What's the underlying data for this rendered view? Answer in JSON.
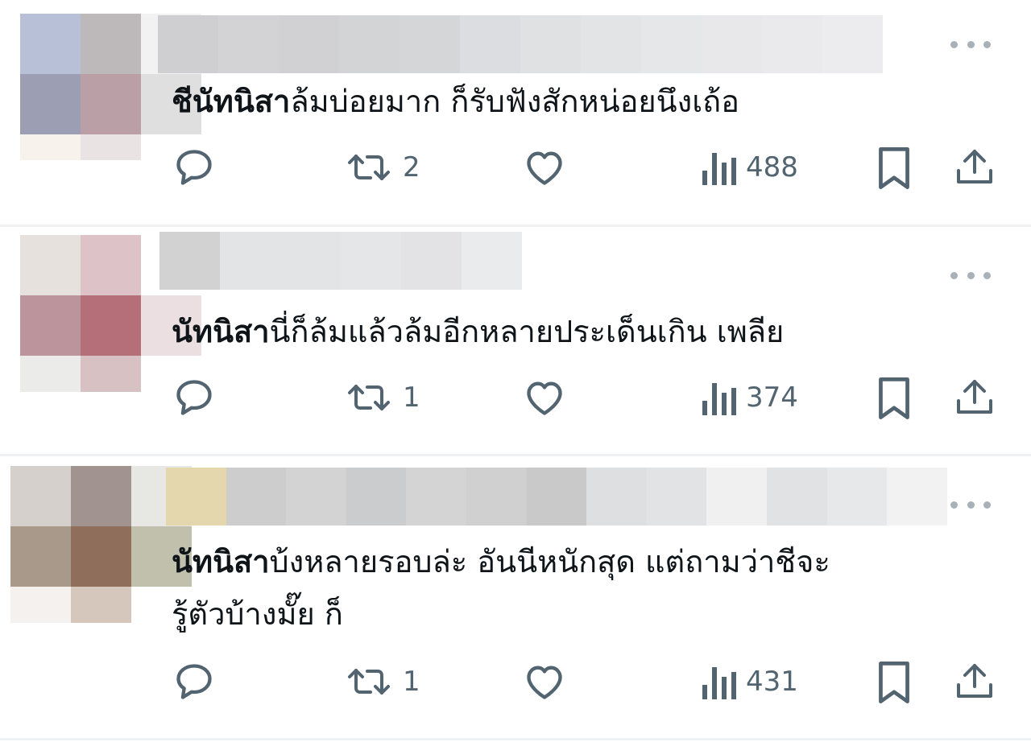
{
  "replies": [
    {
      "name": "ชีนัทนิสา",
      "text": "ล้มบ่อยมาก ก็รับฟังสักหน่อยนึงเถ้อ",
      "retweets": "2",
      "views": "488"
    },
    {
      "name": "นัทนิสา",
      "text": "นี่ก็ล้มแล้วล้มอีกหลายประเด็นเกิน เพลีย",
      "retweets": "1",
      "views": "374"
    },
    {
      "name": "นัทนิสา",
      "text": "บ้งหลายรอบล่ะ อันนีหนักสุด แต่ถามว่าชีจะ",
      "text_line2": "รู้ตัวบ้างมั๊ย ก็",
      "retweets": "1",
      "views": "431"
    }
  ],
  "icons": {
    "reply": "speech-bubble-icon",
    "retweet": "retweet-arrows-icon",
    "like": "heart-icon",
    "views": "bar-chart-icon",
    "bookmark": "bookmark-icon",
    "share": "share-upload-icon",
    "more": "ellipsis-icon"
  },
  "colors": {
    "icon": "#536471",
    "text": "#0f1419",
    "divider": "#eff1f3",
    "more_dots": "#a8b1b8"
  }
}
